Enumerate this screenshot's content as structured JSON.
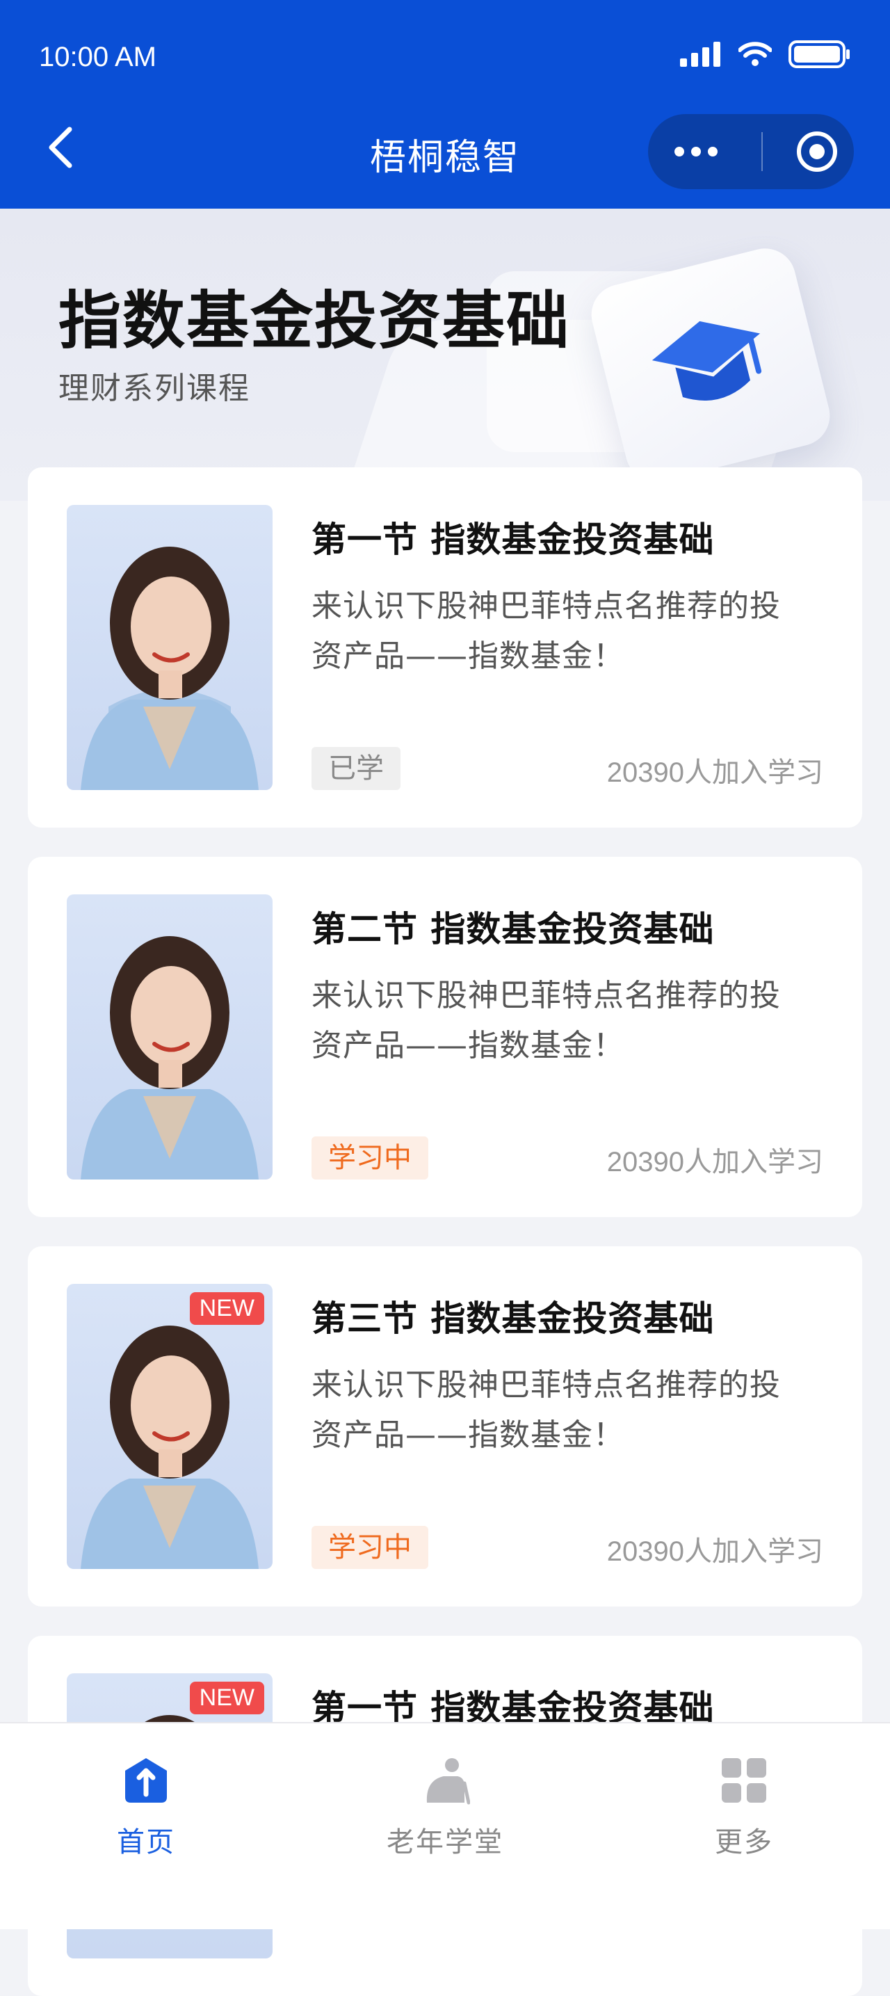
{
  "status_bar": {
    "time": "10:00 AM"
  },
  "nav": {
    "title": "梧桐稳智"
  },
  "banner": {
    "title": "指数基金投资基础",
    "subtitle": "理财系列课程"
  },
  "courses": [
    {
      "title": "第一节 指数基金投资基础",
      "desc_line1": "来认识下股神巴菲特点名推荐的投",
      "desc_line2": "资产品——指数基金！",
      "tag": "已学",
      "count": "20390人加入学习",
      "badge": ""
    },
    {
      "title": "第二节 指数基金投资基础",
      "desc_line1": "来认识下股神巴菲特点名推荐的投",
      "desc_line2": "资产品——指数基金！",
      "tag": "学习中",
      "count": "20390人加入学习",
      "badge": ""
    },
    {
      "title": "第三节 指数基金投资基础",
      "desc_line1": "来认识下股神巴菲特点名推荐的投",
      "desc_line2": "资产品——指数基金！",
      "tag": "学习中",
      "count": "20390人加入学习",
      "badge": "NEW"
    },
    {
      "title": "第一节 指数基金投资基础",
      "badge": "NEW"
    }
  ],
  "tabbar": {
    "home": "首页",
    "senior": "老年学堂",
    "more": "更多"
  },
  "colors": {
    "primary": "#0a4fd6",
    "accent_orange": "#ef6a1e",
    "badge_red": "#f04b4b"
  }
}
